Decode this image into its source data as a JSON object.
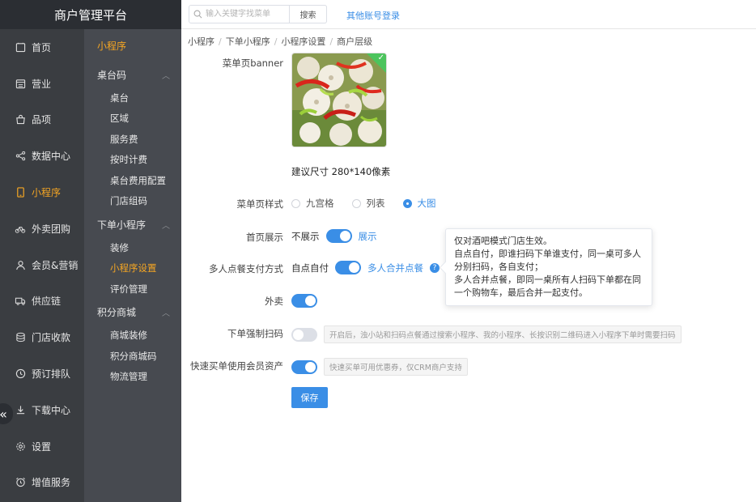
{
  "app": {
    "title": "商户管理平台"
  },
  "nav": {
    "items": [
      {
        "label": "首页",
        "icon": "home-icon"
      },
      {
        "label": "营业",
        "icon": "calendar-icon"
      },
      {
        "label": "品项",
        "icon": "bag-icon"
      },
      {
        "label": "数据中心",
        "icon": "share-icon"
      },
      {
        "label": "小程序",
        "icon": "mobile-icon",
        "active": true
      },
      {
        "label": "外卖团购",
        "icon": "bike-icon"
      },
      {
        "label": "会员&营销",
        "icon": "user-icon"
      },
      {
        "label": "供应链",
        "icon": "truck-icon"
      },
      {
        "label": "门店收款",
        "icon": "coins-icon"
      },
      {
        "label": "预订排队",
        "icon": "clock-icon"
      },
      {
        "label": "下载中心",
        "icon": "download-icon"
      },
      {
        "label": "设置",
        "icon": "gear-icon"
      },
      {
        "label": "增值服务",
        "icon": "alarm-icon"
      }
    ],
    "collapse_glyph": "«"
  },
  "submenu": {
    "title": "小程序",
    "groups": [
      {
        "label": "桌台码",
        "items": [
          "桌台",
          "区域",
          "服务费",
          "按时计费",
          "桌台费用配置",
          "门店组码"
        ]
      },
      {
        "label": "下单小程序",
        "items": [
          "装修",
          "小程序设置",
          "评价管理"
        ]
      },
      {
        "label": "积分商城",
        "items": [
          "商城装修",
          "积分商城码",
          "物流管理"
        ]
      }
    ]
  },
  "topbar": {
    "search_placeholder": "输入关键字找菜单",
    "search_button": "搜索",
    "other_login": "其他账号登录"
  },
  "breadcrumb": [
    "小程序",
    "下单小程序",
    "小程序设置",
    "商户层级"
  ],
  "form": {
    "banner_label": "菜单页banner",
    "size_tip": "建议尺寸 280*140像素",
    "style_label": "菜单页样式",
    "style_options": [
      "九宫格",
      "列表",
      "大图"
    ],
    "style_selected": "大图",
    "home_label": "首页展示",
    "home_off": "不展示",
    "home_on": "展示",
    "pay_label": "多人点餐支付方式",
    "pay_off": "自点自付",
    "pay_on": "多人合并点餐",
    "help_glyph": "?",
    "takeout_label": "外卖",
    "force_scan_label": "下单强制扫码",
    "force_scan_hint": "开启后，浊小站和扫码点餐通过搜索小程序、我的小程序、长按识别二维码进入小程序下单时需要扫码",
    "member_label": "快速买单使用会员资产",
    "member_hint": "快速买单可用优惠券，仅CRM商户支持",
    "save": "保存"
  },
  "tooltip": {
    "line1": "仅对酒吧模式门店生效。",
    "line2": "自点自付，即谁扫码下单谁支付，同一桌可多人分别扫码，各自支付；",
    "line3": "多人合并点餐，即同一桌所有人扫码下单都在同一个购物车，最后合并一起支付。"
  },
  "colors": {
    "accent": "#3a8ee6",
    "active_nav": "#f5a623",
    "nav_bg": "#3a3d41",
    "sub_bg": "#474a50"
  }
}
